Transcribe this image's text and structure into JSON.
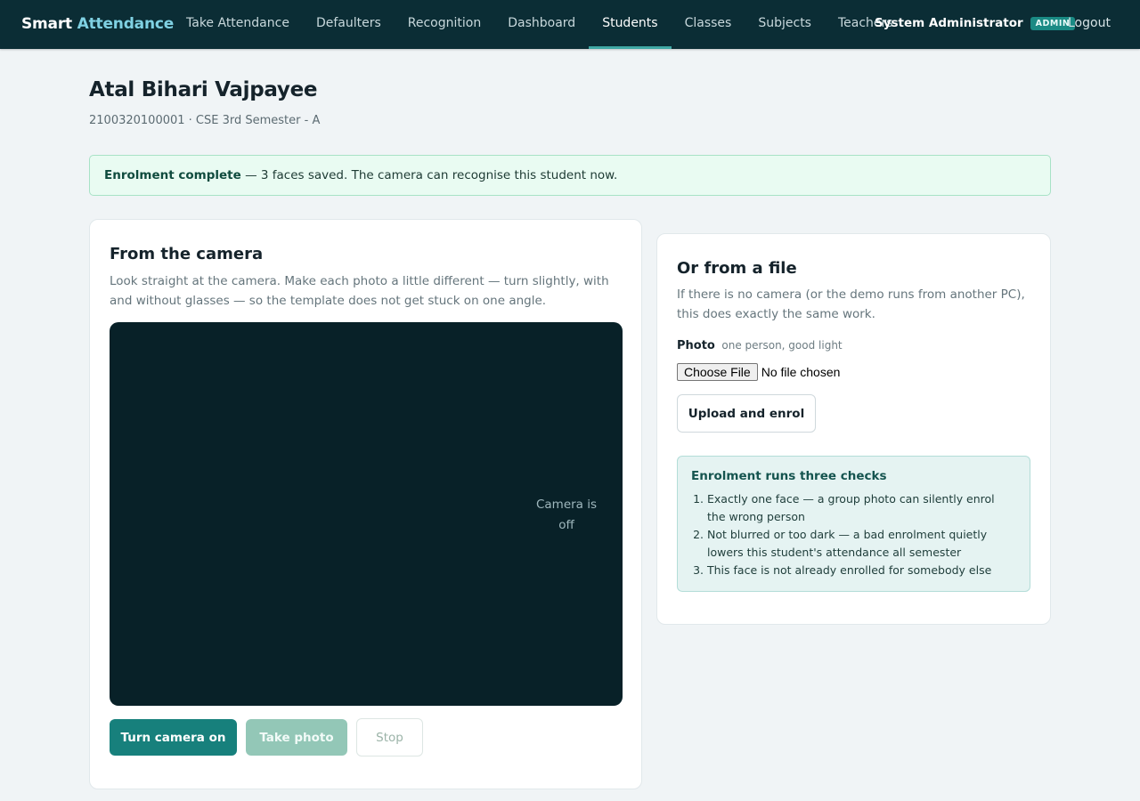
{
  "brand": {
    "part1": "Smart",
    "part2": "Attendance"
  },
  "nav": {
    "items": [
      {
        "label": "Take Attendance"
      },
      {
        "label": "Defaulters"
      },
      {
        "label": "Recognition"
      },
      {
        "label": "Dashboard"
      },
      {
        "label": "Students",
        "active": true
      },
      {
        "label": "Classes"
      },
      {
        "label": "Subjects"
      },
      {
        "label": "Teachers"
      }
    ],
    "user_name": "System Administrator",
    "user_badge": "ADMIN",
    "logout_label": "Logout"
  },
  "student": {
    "name": "Atal Bihari Vajpayee",
    "meta": "2100320100001 · CSE 3rd Semester - A"
  },
  "alert": {
    "strong": "Enrolment complete",
    "text": " — 3 faces saved. The camera can recognise this student now."
  },
  "camera": {
    "title": "From the camera",
    "description": "Look straight at the camera. Make each photo a little different — turn slightly, with and without glasses — so the template does not get stuck on one angle.",
    "status": "Camera is off",
    "btn_on": "Turn camera on",
    "btn_photo": "Take photo",
    "btn_stop": "Stop"
  },
  "file": {
    "title": "Or from a file",
    "description": "If there is no camera (or the demo runs from another PC), this does exactly the same work.",
    "photo_label": "Photo",
    "photo_hint": "one person, good light",
    "choose_label": "Choose File",
    "no_file": "No file chosen",
    "upload_label": "Upload and enrol",
    "checks_title": "Enrolment runs three checks",
    "checks": [
      "Exactly one face — a group photo can silently enrol the wrong person",
      "Not blurred or too dark — a bad enrolment quietly lowers this student's attendance all semester",
      "This face is not already enrolled for somebody else"
    ]
  },
  "colors": {
    "topbar": "#0b2d35",
    "accent": "#7fd1e3",
    "primary_button": "#17807c",
    "success_bg": "#e9fbf2"
  }
}
